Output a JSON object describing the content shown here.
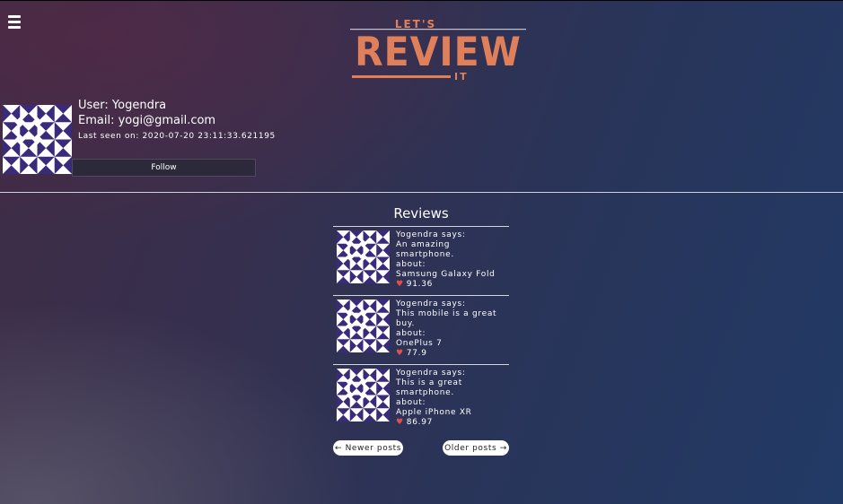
{
  "header": {
    "menu_icon": "hamburger-menu-icon",
    "logo": {
      "top": "LET'S",
      "main": "REVIEW",
      "bottom": "IT"
    }
  },
  "profile": {
    "user_label": "User: Yogendra",
    "email_label": "Email: yogi@gmail.com",
    "last_seen": "Last seen on: 2020-07-20 23:11:33.621195",
    "follow_label": "Follow",
    "avatar_colors": {
      "fg": "#3a2a7a",
      "bg": "#ffffff"
    }
  },
  "reviews": {
    "title": "Reviews",
    "items": [
      {
        "says": "Yogendra says:",
        "text": "An amazing smartphone.",
        "about_label": "about:",
        "product": "Samsung Galaxy Fold",
        "score": "91.36"
      },
      {
        "says": "Yogendra says:",
        "text": "This mobile is a great buy.",
        "about_label": "about:",
        "product": "OnePlus 7",
        "score": "77.9"
      },
      {
        "says": "Yogendra says:",
        "text": "This is a great smartphone.",
        "about_label": "about:",
        "product": "Apple iPhone XR",
        "score": "86.97"
      }
    ]
  },
  "pagination": {
    "newer_label": "← Newer posts",
    "older_label": "Older posts →"
  },
  "colors": {
    "accent": "#e0805a",
    "heart": "#e0504f"
  }
}
